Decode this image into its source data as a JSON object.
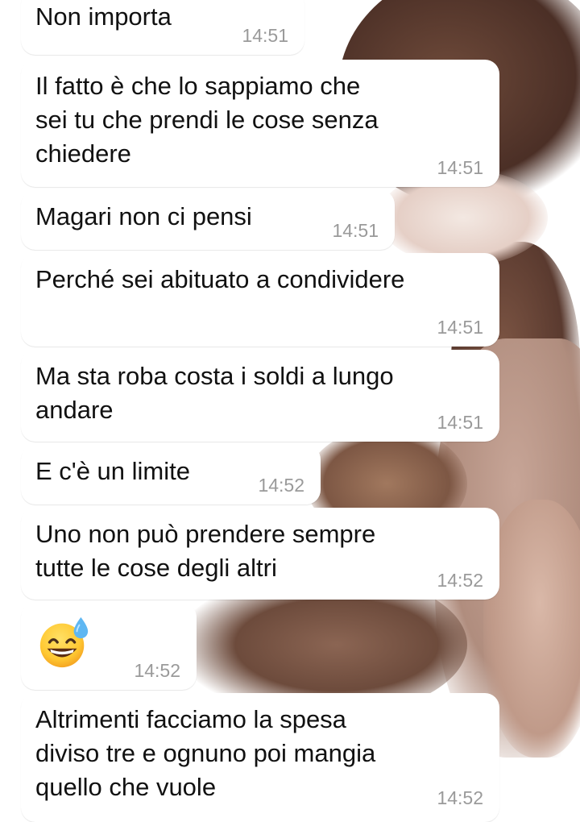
{
  "messages": [
    {
      "text": "Non importa",
      "time": "14:51"
    },
    {
      "text": "Il fatto è che lo sappiamo che\nsei tu che prendi le cose senza\nchiedere",
      "time": "14:51"
    },
    {
      "text": "Magari non ci pensi",
      "time": "14:51"
    },
    {
      "text": "Perché sei abituato a condividere",
      "time": "14:51"
    },
    {
      "text": "Ma sta roba costa i soldi a lungo\nandare",
      "time": "14:51"
    },
    {
      "text": "E c'è un limite",
      "time": "14:52"
    },
    {
      "text": "Uno non può prendere sempre\ntutte le cose degli altri",
      "time": "14:52"
    },
    {
      "emoji": "grinning-face-with-sweat-icon",
      "time": "14:52"
    },
    {
      "text": "Altrimenti facciamo la spesa\ndiviso tre e ognuno poi mangia\nquello che vuole",
      "time": "14:52"
    }
  ],
  "colors": {
    "bubble": "#ffffff",
    "text": "#111111",
    "time": "#9a9a9a"
  }
}
